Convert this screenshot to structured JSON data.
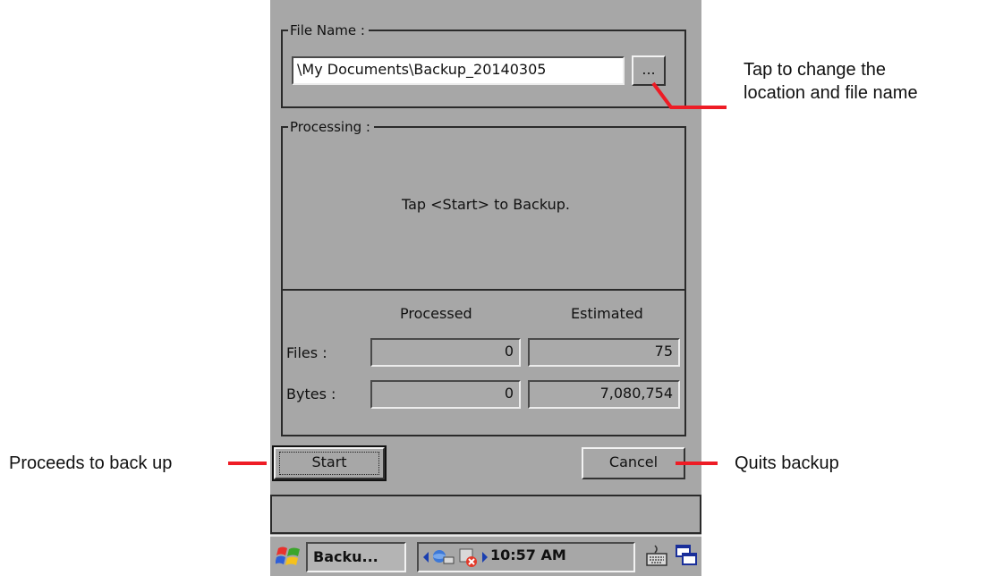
{
  "file_name": {
    "legend": "File Name :",
    "path_value": "\\My Documents\\Backup_20140305",
    "browse_label": "..."
  },
  "processing": {
    "legend": "Processing :",
    "message": "Tap <Start> to Backup.",
    "col_processed": "Processed",
    "col_estimated": "Estimated",
    "rows": [
      {
        "label": "Files :",
        "processed": "0",
        "estimated": "75"
      },
      {
        "label": "Bytes :",
        "processed": "0",
        "estimated": "7,080,754"
      }
    ]
  },
  "buttons": {
    "start": "Start",
    "cancel": "Cancel"
  },
  "taskbar": {
    "task_label": "Backu...",
    "clock": "10:57 AM",
    "icons": [
      "windows-start-icon",
      "tray-left-arrow-icon",
      "network-icon",
      "sync-error-icon",
      "tray-right-arrow-icon",
      "keyboard-icon",
      "switch-windows-icon"
    ]
  },
  "annotations": {
    "browse_line1": "Tap to change the",
    "browse_line2": "location and file name",
    "start": "Proceeds to back up",
    "cancel": "Quits backup"
  },
  "colors": {
    "screen_bg": "#a7a7a7",
    "annotation_pointer": "#ee1c25"
  }
}
